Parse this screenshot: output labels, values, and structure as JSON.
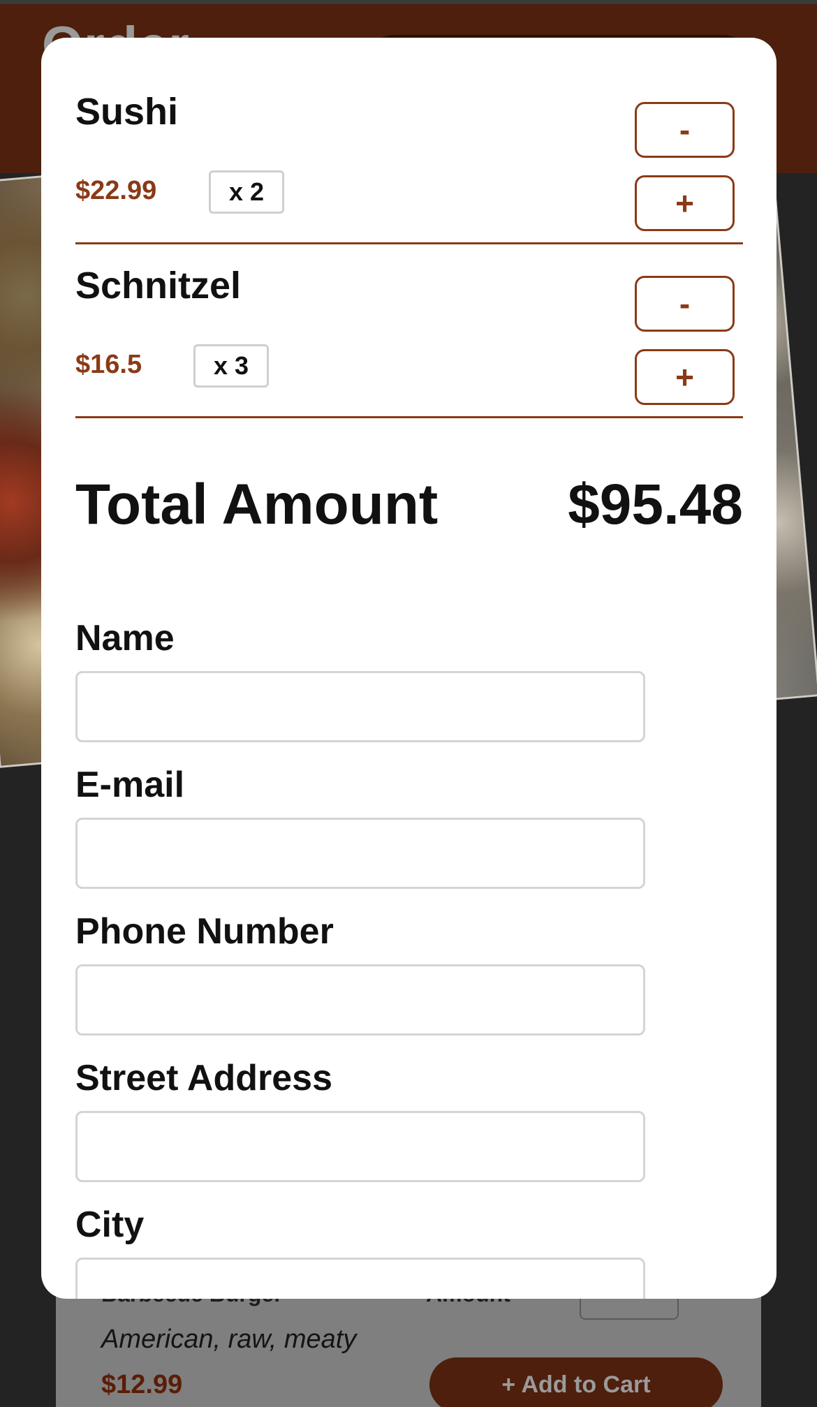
{
  "background": {
    "title": "Order",
    "menu_item": {
      "name": "Barbecue Burger",
      "description": "American, raw, meaty",
      "price": "$12.99",
      "amount_label": "Amount",
      "add_to_cart_label": "+ Add to Cart"
    }
  },
  "cart": {
    "items": [
      {
        "name": "Sushi",
        "price": "$22.99",
        "quantity": "x 2"
      },
      {
        "name": "Schnitzel",
        "price": "$16.5",
        "quantity": "x 3"
      }
    ],
    "minus_label": "-",
    "plus_label": "+",
    "total_label": "Total Amount",
    "total_value": "$95.48"
  },
  "form": {
    "name_label": "Name",
    "email_label": "E-mail",
    "phone_label": "Phone Number",
    "street_label": "Street Address",
    "city_label": "City"
  },
  "colors": {
    "accent": "#8a3a17",
    "header": "#4d1f0c"
  }
}
